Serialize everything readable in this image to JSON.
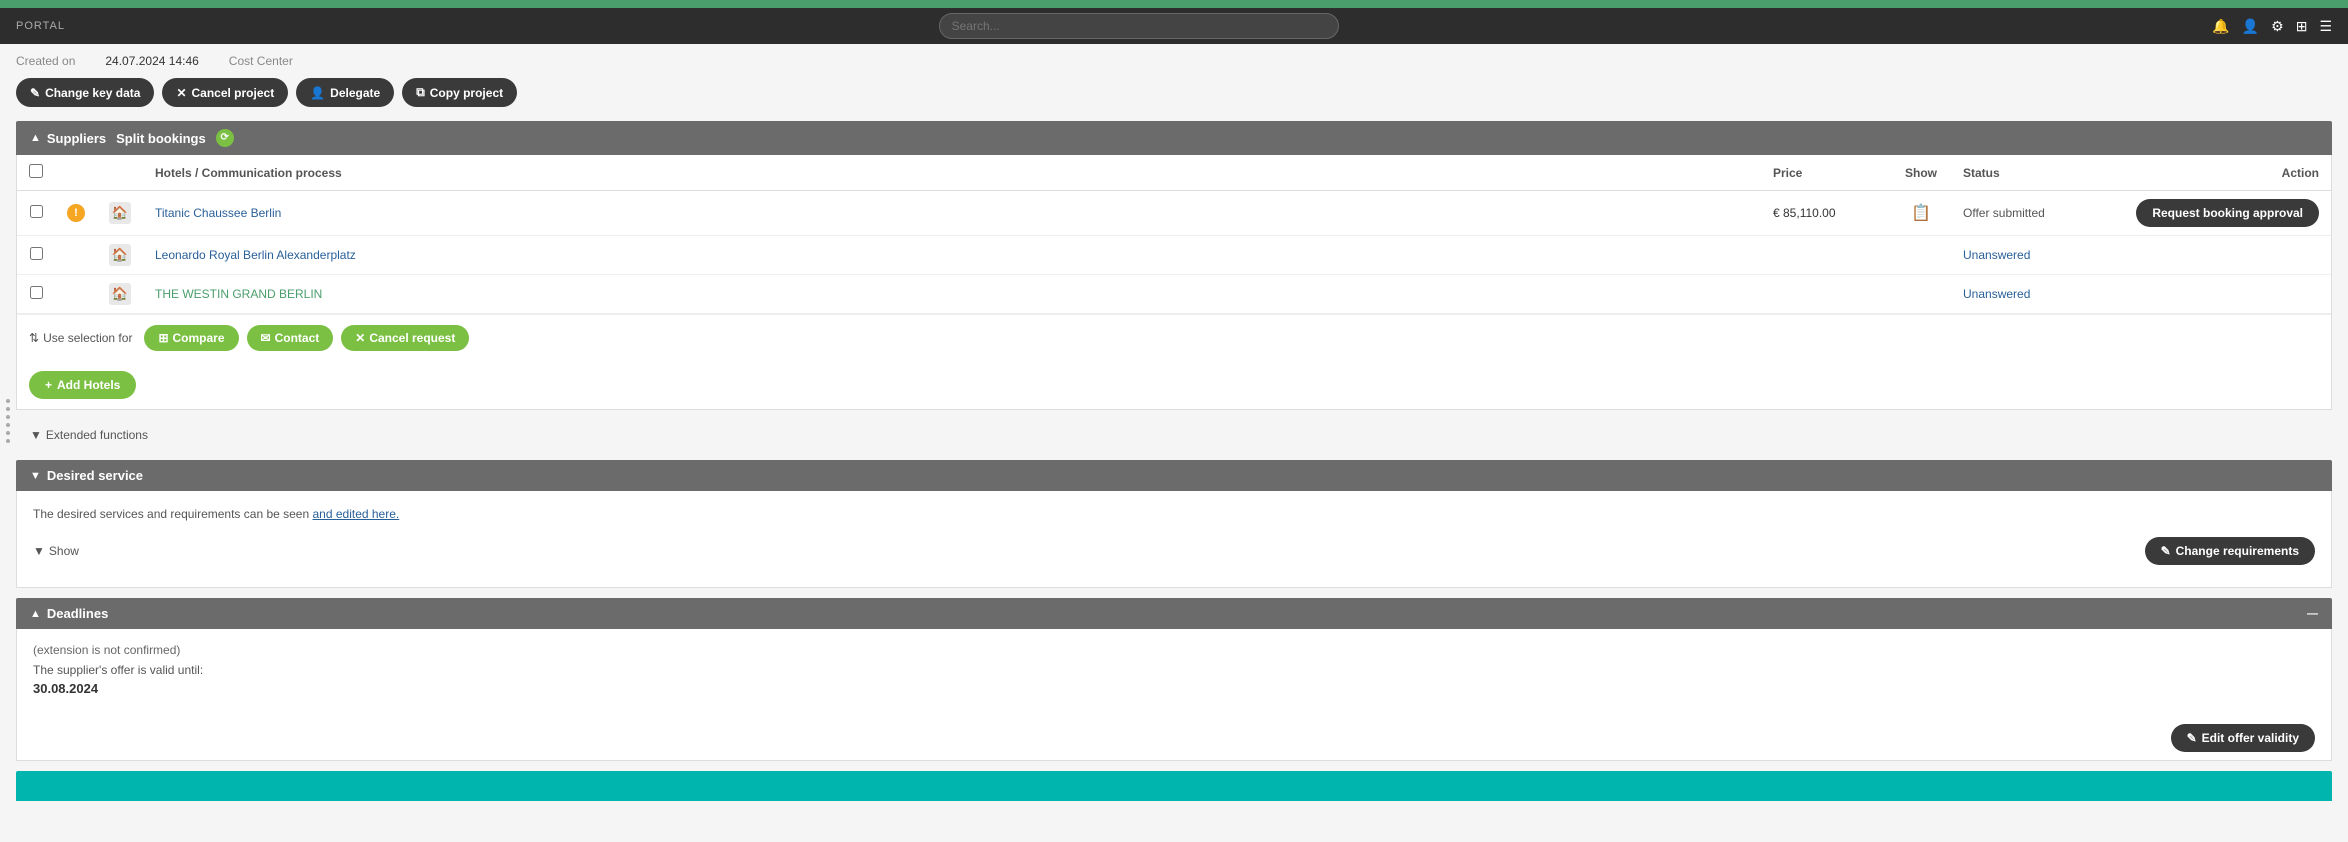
{
  "portal": {
    "label": "PORTAL"
  },
  "header": {
    "search_placeholder": "Search..."
  },
  "meta": {
    "created_on_label": "Created on",
    "created_on_value": "24.07.2024 14:46",
    "cost_center_label": "Cost Center"
  },
  "action_buttons": [
    {
      "id": "change-key-data",
      "label": "Change key data",
      "icon": "✎",
      "style": "dark"
    },
    {
      "id": "cancel-project",
      "label": "Cancel project",
      "icon": "✕",
      "style": "dark"
    },
    {
      "id": "delegate",
      "label": "Delegate",
      "icon": "👤",
      "style": "dark"
    },
    {
      "id": "copy-project",
      "label": "Copy project",
      "icon": "⧉",
      "style": "dark"
    }
  ],
  "suppliers_section": {
    "title": "Suppliers",
    "split_bookings_label": "Split bookings",
    "columns": {
      "checkbox": "",
      "hotel": "Hotels / Communication process",
      "price": "Price",
      "show": "Show",
      "status": "Status",
      "action": "Action"
    },
    "rows": [
      {
        "id": 1,
        "checked": false,
        "has_warning": true,
        "hotel_name": "Titanic Chaussee Berlin",
        "hotel_link": true,
        "price": "€ 85,110.00",
        "has_show_icon": true,
        "status": "Offer submitted",
        "status_class": "submitted",
        "action_label": "Request booking approval",
        "action_style": "dark"
      },
      {
        "id": 2,
        "checked": false,
        "has_warning": false,
        "hotel_name": "Leonardo Royal Berlin Alexanderplatz",
        "hotel_link": true,
        "price": "",
        "has_show_icon": false,
        "status": "Unanswered",
        "status_class": "unanswered",
        "action_label": "",
        "action_style": ""
      },
      {
        "id": 3,
        "checked": false,
        "has_warning": false,
        "hotel_name": "THE WESTIN GRAND BERLIN",
        "hotel_link": true,
        "price": "",
        "has_show_icon": false,
        "status": "Unanswered",
        "status_class": "unanswered",
        "action_label": "",
        "action_style": ""
      }
    ],
    "selection_label": "Use selection for",
    "compare_label": "Compare",
    "contact_label": "Contact",
    "cancel_request_label": "Cancel request",
    "add_hotels_label": "Add Hotels"
  },
  "extended_functions": {
    "label": "Extended functions"
  },
  "desired_service": {
    "title": "Desired service",
    "description_start": "The desired services and requirements can be seen",
    "description_link": "and edited here.",
    "show_label": "Show",
    "change_requirements_label": "Change requirements",
    "change_requirements_icon": "✎"
  },
  "deadlines": {
    "title": "Deadlines",
    "extension_note": "(extension is not confirmed)",
    "valid_until_label": "The supplier's offer is valid until:",
    "valid_until_date": "30.08.2024",
    "edit_offer_validity_label": "Edit offer validity",
    "edit_offer_validity_icon": "✎"
  },
  "teal_section": {
    "color": "#00b5ad"
  },
  "icons": {
    "chevron_up": "▲",
    "chevron_down": "▼",
    "plus": "+",
    "edit": "✎",
    "search": "🔍",
    "home": "🏠",
    "compare": "⊞",
    "envelope": "✉",
    "times": "✕",
    "arrows": "⇅"
  }
}
